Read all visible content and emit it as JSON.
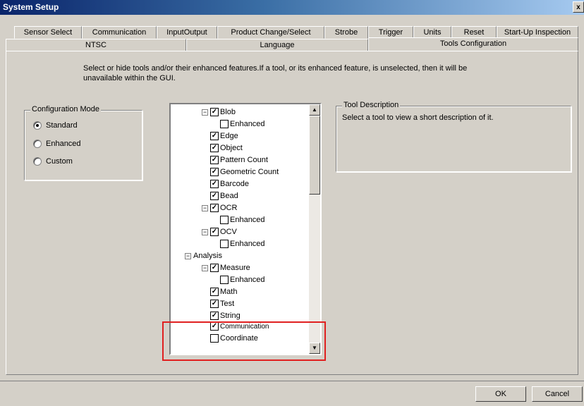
{
  "window": {
    "title": "System Setup",
    "close_label": "x"
  },
  "tabs_row1": [
    "Sensor Select",
    "Communication",
    "InputOutput",
    "Product Change/Select",
    "Strobe",
    "Trigger",
    "Units",
    "Reset",
    "Start-Up Inspection"
  ],
  "tabs_row2": [
    "NTSC",
    "Language",
    "Tools Configuration"
  ],
  "active_tab": "Tools Configuration",
  "intro_text": "Select or hide tools and/or their enhanced features.If a tool, or its enhanced feature, is unselected, then it will be unavailable within the GUI.",
  "config_mode": {
    "title": "Configuration Mode",
    "options": [
      "Standard",
      "Enhanced",
      "Custom"
    ],
    "selected": "Standard"
  },
  "tree": {
    "items": [
      {
        "label": "Blob",
        "checked": true
      },
      {
        "label": "Enhanced",
        "checked": false
      },
      {
        "label": "Edge",
        "checked": true
      },
      {
        "label": "Object",
        "checked": true
      },
      {
        "label": "Pattern Count",
        "checked": true
      },
      {
        "label": "Geometric Count",
        "checked": true
      },
      {
        "label": "Barcode",
        "checked": true
      },
      {
        "label": "Bead",
        "checked": true
      },
      {
        "label": "OCR",
        "checked": true
      },
      {
        "label": "Enhanced",
        "checked": false
      },
      {
        "label": "OCV",
        "checked": true
      },
      {
        "label": "Enhanced",
        "checked": false
      },
      {
        "label": "Analysis",
        "checked": null
      },
      {
        "label": "Measure",
        "checked": true
      },
      {
        "label": "Enhanced",
        "checked": false
      },
      {
        "label": "Math",
        "checked": true
      },
      {
        "label": "Test",
        "checked": true
      },
      {
        "label": "String",
        "checked": true
      },
      {
        "label": "Communication",
        "checked": true
      },
      {
        "label": "Coordinate",
        "checked": false
      }
    ]
  },
  "tool_description": {
    "title": "Tool Description",
    "text": "Select a tool to view a short description of it."
  },
  "buttons": {
    "ok": "OK",
    "cancel": "Cancel"
  },
  "colors": {
    "highlight": "#e02020",
    "titlebar": "#0a246a"
  }
}
